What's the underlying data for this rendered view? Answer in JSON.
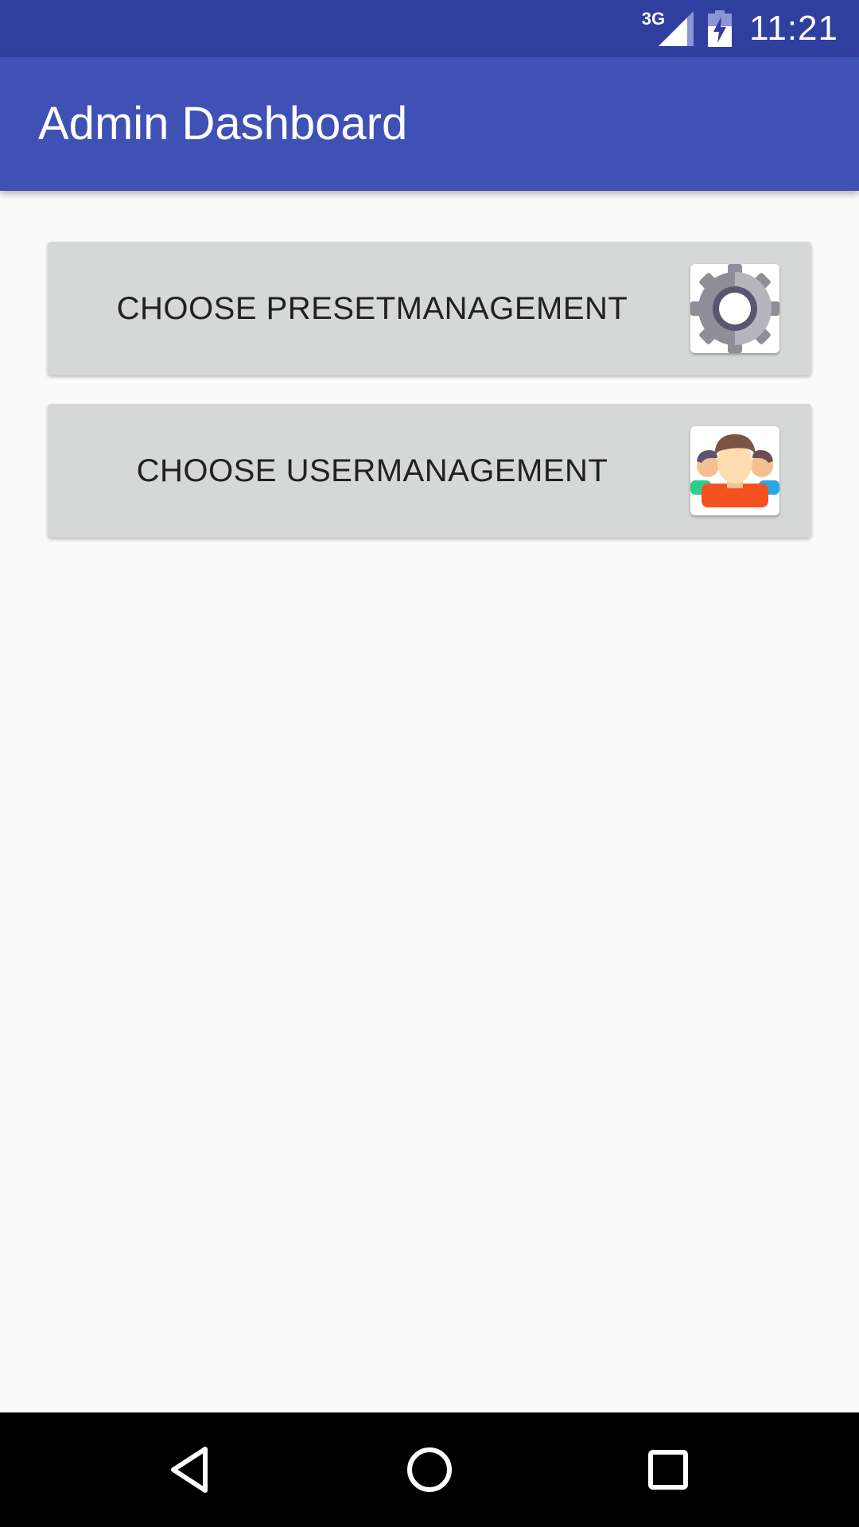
{
  "status_bar": {
    "network_type": "3G",
    "time": "11:21",
    "icons": [
      "signal-icon",
      "battery-charging-icon"
    ]
  },
  "app_bar": {
    "title": "Admin Dashboard"
  },
  "actions": [
    {
      "label": "CHOOSE PRESETMANAGEMENT",
      "icon": "gear-icon"
    },
    {
      "label": "CHOOSE USERMANAGEMENT",
      "icon": "users-group-icon"
    }
  ],
  "nav_bar": {
    "icons": [
      "back-icon",
      "home-icon",
      "recent-apps-icon"
    ]
  },
  "colors": {
    "status_bar": "#303f9f",
    "app_bar": "#3f51b5",
    "button_bg": "#d6d7d7",
    "background": "#fafafa"
  }
}
